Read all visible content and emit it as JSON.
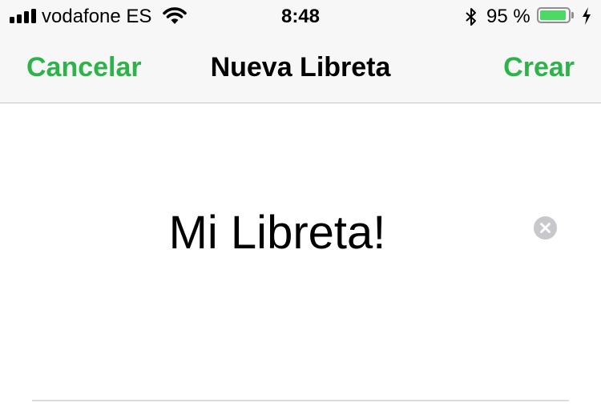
{
  "status_bar": {
    "carrier": "vodafone ES",
    "time": "8:48",
    "battery_percent": "95 %",
    "battery_level": 0.95,
    "signal_bars": 4,
    "icons": [
      "signal-icon",
      "wifi-icon",
      "bluetooth-icon",
      "battery-icon",
      "charging-icon"
    ]
  },
  "nav": {
    "cancel_label": "Cancelar",
    "title": "Nueva Libreta",
    "create_label": "Crear"
  },
  "form": {
    "notebook_name_value": "Mi Libreta!",
    "clear_icon": "clear-icon"
  },
  "colors": {
    "accent": "#2db34a",
    "battery_fill": "#4cd964",
    "nav_background": "#f7f7f7"
  }
}
